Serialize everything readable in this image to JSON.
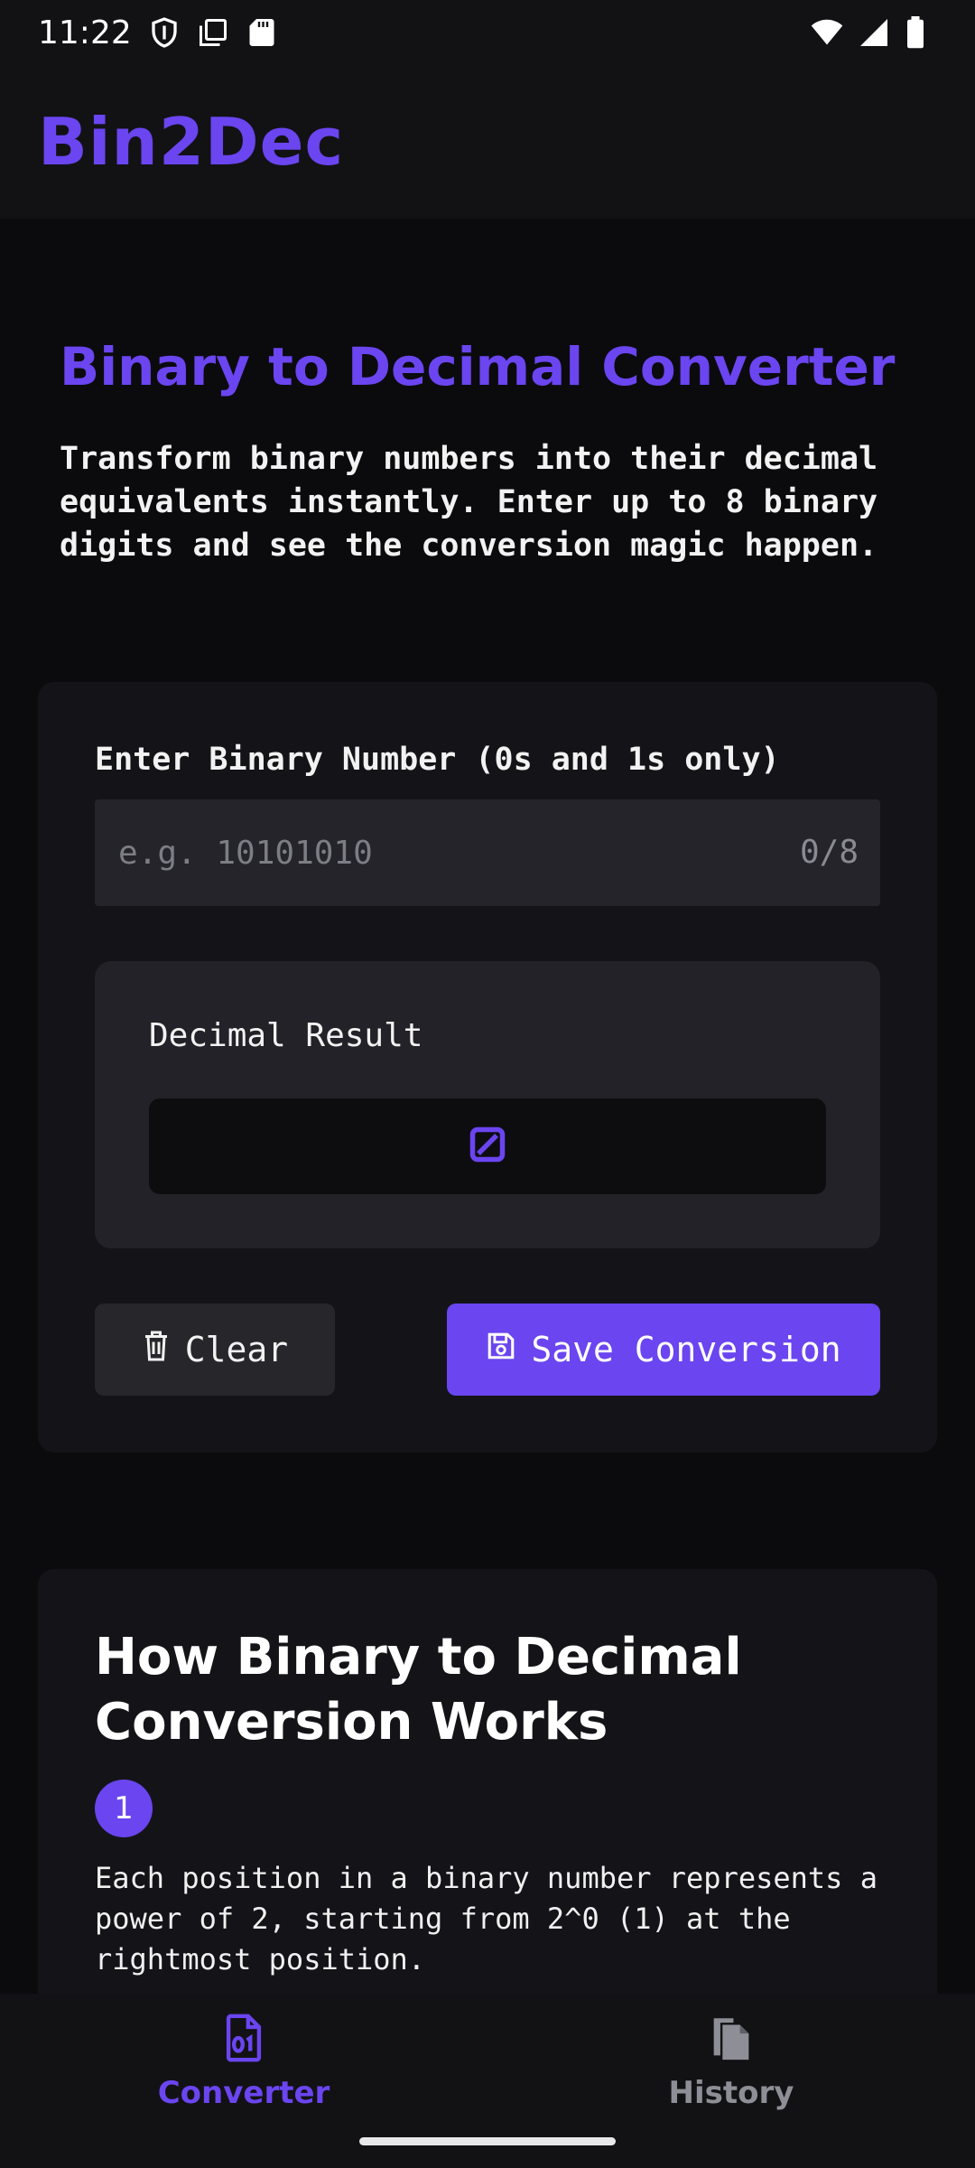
{
  "status_bar": {
    "time": "11:22",
    "left_icons": [
      "shield-icon",
      "screenshot-icon",
      "sd-card-icon"
    ],
    "right_icons": [
      "wifi-icon",
      "signal-icon",
      "battery-icon"
    ]
  },
  "app_bar": {
    "title": "Bin2Dec"
  },
  "header": {
    "title": "Binary to Decimal Converter",
    "description": "Transform binary numbers into their decimal equivalents instantly. Enter up to 8 binary digits and see the conversion magic happen."
  },
  "converter": {
    "input_label": "Enter Binary Number (0s and 1s only)",
    "input_value": "",
    "input_placeholder": "e.g. 10101010",
    "char_counter": "0/8",
    "result_label": "Decimal Result",
    "result_value": "",
    "result_icon": "empty-result-icon",
    "clear_label": "Clear",
    "save_label": "Save Conversion"
  },
  "info": {
    "title": "How Binary to Decimal Conversion Works",
    "steps": [
      {
        "number": "1",
        "text": "Each position in a binary number represents a power of 2, starting from 2^0 (1) at the rightmost position."
      }
    ]
  },
  "bottom_nav": {
    "items": [
      {
        "label": "Converter",
        "icon": "binary-file-icon",
        "active": true
      },
      {
        "label": "History",
        "icon": "history-files-icon",
        "active": false
      }
    ]
  },
  "colors": {
    "accent": "#6a45f0",
    "background": "#0b0b0d",
    "card": "#141418",
    "inactive": "#8e8e96"
  }
}
